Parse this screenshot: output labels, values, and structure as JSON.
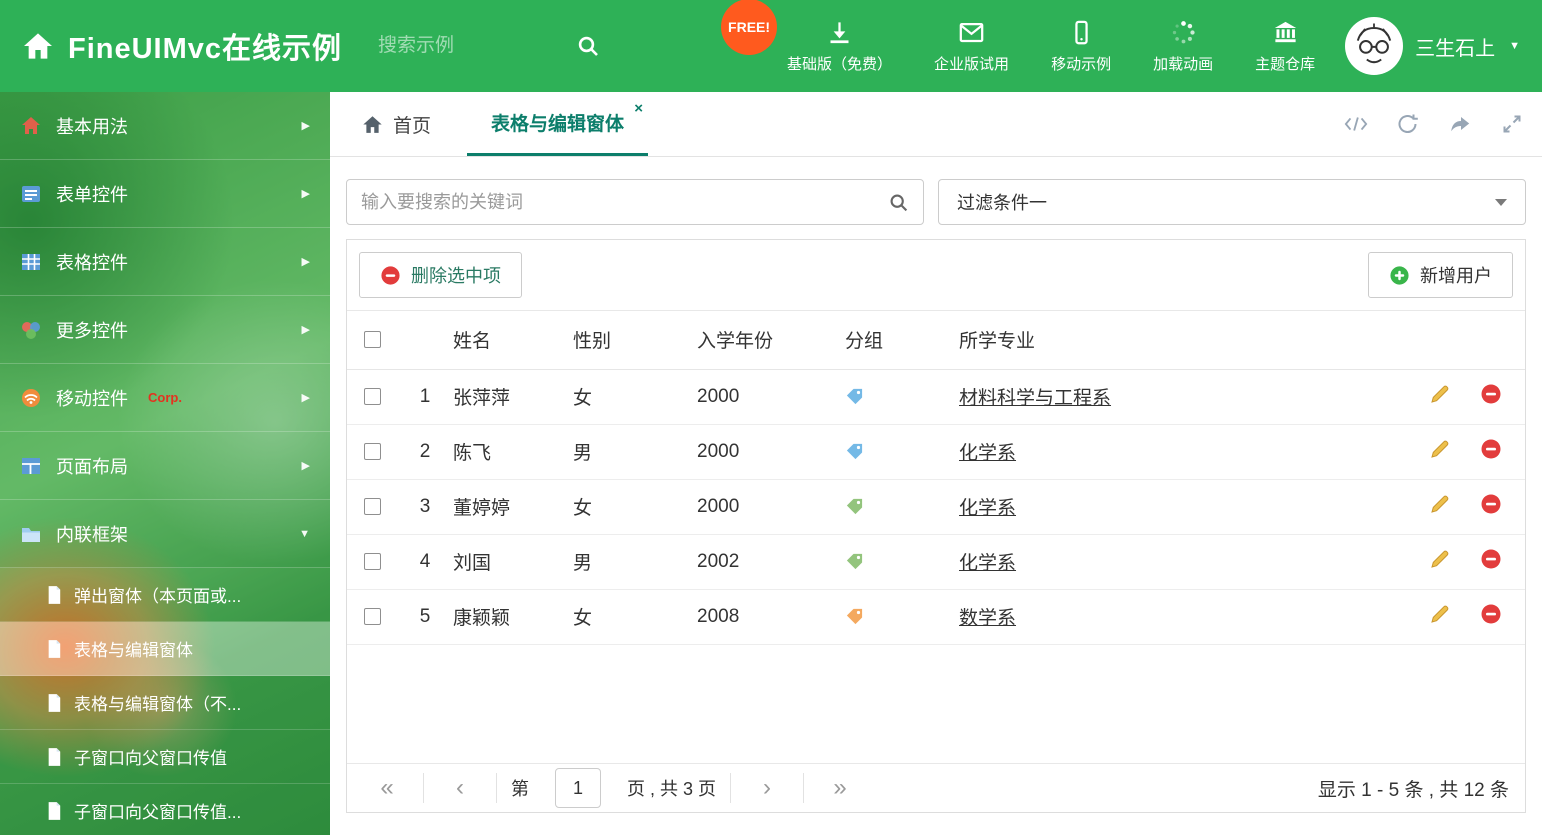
{
  "colors": {
    "header_green": "#2eb157",
    "accent_teal": "#0c7e6b",
    "free_badge_bg": "#ff5a1e",
    "tag_blue": "#74b9e6",
    "tag_green": "#93c47d",
    "tag_orange": "#f4a95f",
    "edit_icon": "#edc04b",
    "delete_icon": "#e23c3c",
    "add_icon": "#39b54a"
  },
  "icons": {
    "tab_close": "×",
    "caret_down": "▼",
    "menu_collapsed": "▶",
    "menu_expanded": "▼",
    "pg_first": "«",
    "pg_prev": "‹",
    "pg_next": "›",
    "pg_last": "»"
  },
  "header": {
    "title": "FineUIMvc在线示例",
    "search_placeholder": "搜索示例",
    "free_badge": "FREE!",
    "nav": [
      {
        "icon": "download-icon",
        "label": "基础版（免费）"
      },
      {
        "icon": "envelope-icon",
        "label": "企业版试用"
      },
      {
        "icon": "mobile-icon",
        "label": "移动示例"
      },
      {
        "icon": "loading-icon",
        "label": "加载动画"
      },
      {
        "icon": "bank-icon",
        "label": "主题仓库"
      }
    ],
    "username": "三生石上"
  },
  "sidebar": {
    "items": [
      {
        "label": "基本用法"
      },
      {
        "label": "表单控件"
      },
      {
        "label": "表格控件"
      },
      {
        "label": "更多控件"
      },
      {
        "label": "移动控件",
        "badge": "Corp."
      },
      {
        "label": "页面布局"
      },
      {
        "label": "内联框架"
      }
    ],
    "subitems": [
      {
        "label": "弹出窗体（本页面或..."
      },
      {
        "label": "表格与编辑窗体"
      },
      {
        "label": "表格与编辑窗体（不..."
      },
      {
        "label": "子窗口向父窗口传值"
      },
      {
        "label": "子窗口向父窗口传值..."
      }
    ]
  },
  "tabs": {
    "home": "首页",
    "active": "表格与编辑窗体"
  },
  "filters": {
    "search_placeholder": "输入要搜索的关键词",
    "filter_selected": "过滤条件一"
  },
  "panel": {
    "delete_button": "删除选中项",
    "add_button": "新增用户",
    "table": {
      "headers": {
        "name": "姓名",
        "gender": "性别",
        "year": "入学年份",
        "group": "分组",
        "major": "所学专业"
      },
      "rows": [
        {
          "num": "1",
          "name": "张萍萍",
          "gender": "女",
          "year": "2000",
          "tag_color": "#74b9e6",
          "major": "材料科学与工程系"
        },
        {
          "num": "2",
          "name": "陈飞",
          "gender": "男",
          "year": "2000",
          "tag_color": "#74b9e6",
          "major": "化学系"
        },
        {
          "num": "3",
          "name": "董婷婷",
          "gender": "女",
          "year": "2000",
          "tag_color": "#93c47d",
          "major": "化学系"
        },
        {
          "num": "4",
          "name": "刘国",
          "gender": "男",
          "year": "2002",
          "tag_color": "#93c47d",
          "major": "化学系"
        },
        {
          "num": "5",
          "name": "康颖颖",
          "gender": "女",
          "year": "2008",
          "tag_color": "#f4a95f",
          "major": "数学系"
        }
      ]
    },
    "pagination": {
      "page_label_prefix": "第",
      "page_value": "1",
      "page_label_suffix": "页 , 共 3 页",
      "summary": "显示 1 - 5 条 , 共 12 条"
    }
  }
}
